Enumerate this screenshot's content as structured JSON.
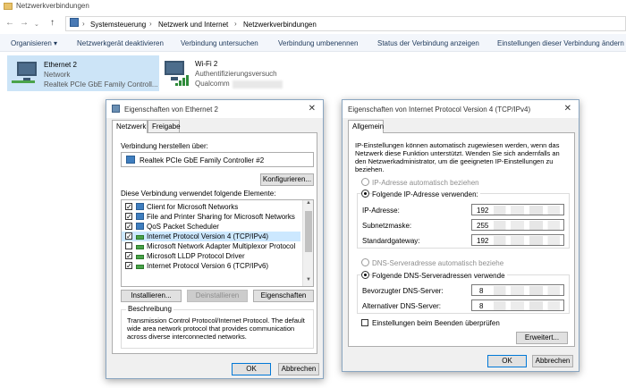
{
  "window": {
    "title": "Netzwerkverbindungen"
  },
  "address": {
    "crumbs": [
      "Systemsteuerung",
      "Netzwerk und Internet",
      "Netzwerkverbindungen"
    ]
  },
  "commands": {
    "organize": "Organisieren ▾",
    "disable": "Netzwerkgerät deaktivieren",
    "diagnose": "Verbindung untersuchen",
    "rename": "Verbindung umbenennen",
    "status": "Status der Verbindung anzeigen",
    "settings": "Einstellungen dieser Verbindung ändern"
  },
  "adapters": [
    {
      "name": "Ethernet 2",
      "status": "Network",
      "device": "Realtek PCIe GbE Family Controll..."
    },
    {
      "name": "Wi-Fi 2",
      "status": "Authentifizierungsversuch",
      "device": "Qualcomm"
    }
  ],
  "eth_dialog": {
    "title": "Eigenschaften von Ethernet 2",
    "tabs": [
      "Netzwerk",
      "Freigabe"
    ],
    "connect_using_label": "Verbindung herstellen über:",
    "adapter_name": "Realtek PCIe GbE Family Controller #2",
    "configure_btn": "Konfigurieren...",
    "items_label": "Diese Verbindung verwendet folgende Elemente:",
    "components": [
      {
        "label": "Client for Microsoft Networks",
        "checked": true
      },
      {
        "label": "File and Printer Sharing for Microsoft Networks",
        "checked": true
      },
      {
        "label": "QoS Packet Scheduler",
        "checked": true
      },
      {
        "label": "Internet Protocol Version 4 (TCP/IPv4)",
        "checked": true
      },
      {
        "label": "Microsoft Network Adapter Multiplexor Protocol",
        "checked": false
      },
      {
        "label": "Microsoft LLDP Protocol Driver",
        "checked": true
      },
      {
        "label": "Internet Protocol Version 6 (TCP/IPv6)",
        "checked": true
      }
    ],
    "install_btn": "Installieren...",
    "uninstall_btn": "Deinstallieren",
    "properties_btn": "Eigenschaften",
    "desc_legend": "Beschreibung",
    "description": "Transmission Control Protocol/Internet Protocol. The default wide area network protocol that provides communication across diverse interconnected networks.",
    "ok": "OK",
    "cancel": "Abbrechen"
  },
  "ipv4_dialog": {
    "title": "Eigenschaften von Internet Protocol Version 4 (TCP/IPv4)",
    "tab": "Allgemein",
    "intro": "IP-Einstellungen können automatisch zugewiesen werden, wenn das Netzwerk diese Funktion unterstützt. Wenden Sie sich andernfalls an den Netzwerkadministrator, um die geeigneten IP-Einstellungen zu beziehen.",
    "auto_ip": "IP-Adresse automatisch beziehen",
    "manual_ip": "Folgende IP-Adresse verwenden:",
    "ip_label": "IP-Adresse:",
    "ip_value": "192",
    "mask_label": "Subnetzmaske:",
    "mask_value": "255",
    "gw_label": "Standardgateway:",
    "gw_value": "192",
    "auto_dns": "DNS-Serveradresse automatisch beziehe",
    "manual_dns": "Folgende DNS-Serveradressen verwende",
    "dns1_label": "Bevorzugter DNS-Server:",
    "dns1_value": "8",
    "dns2_label": "Alternativer DNS-Server:",
    "dns2_value": "8",
    "validate": "Einstellungen beim Beenden überprüfen",
    "advanced_btn": "Erweitert...",
    "ok": "OK",
    "cancel": "Abbrechen"
  }
}
